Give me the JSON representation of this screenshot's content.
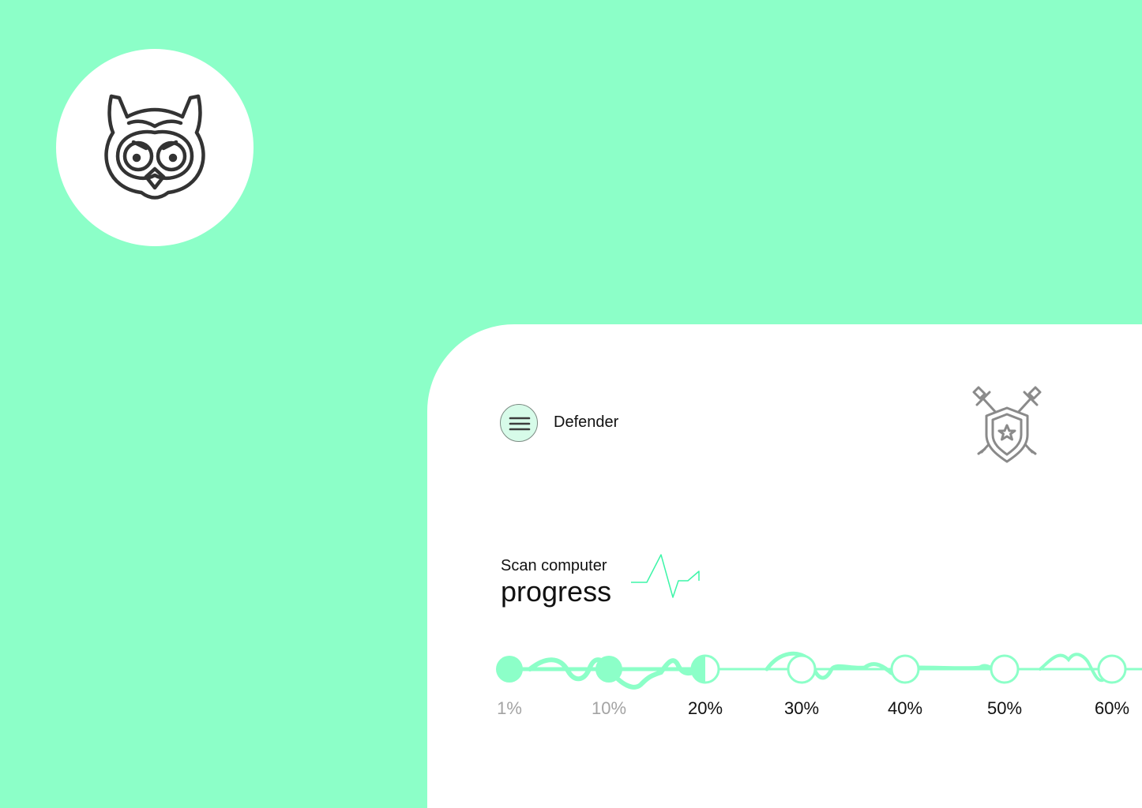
{
  "app": {
    "title": "Defender"
  },
  "icons": {
    "logo": "owl-icon",
    "menu": "hamburger-menu-icon",
    "emblem": "shield-crossed-swords-icon",
    "pulse": "pulse-line-icon"
  },
  "scan": {
    "label": "Scan computer",
    "title": "progress"
  },
  "progress": {
    "markers": [
      {
        "label": "1%",
        "state": "done"
      },
      {
        "label": "10%",
        "state": "done"
      },
      {
        "label": "20%",
        "state": "current"
      },
      {
        "label": "30%",
        "state": "pending"
      },
      {
        "label": "40%",
        "state": "pending"
      },
      {
        "label": "50%",
        "state": "pending"
      },
      {
        "label": "60%",
        "state": "pending"
      }
    ]
  },
  "colors": {
    "background": "#8cffc8",
    "accent": "#8cffc8",
    "pulse": "#3df5a8",
    "icon": "#333333",
    "muted": "#a3a3a3"
  }
}
